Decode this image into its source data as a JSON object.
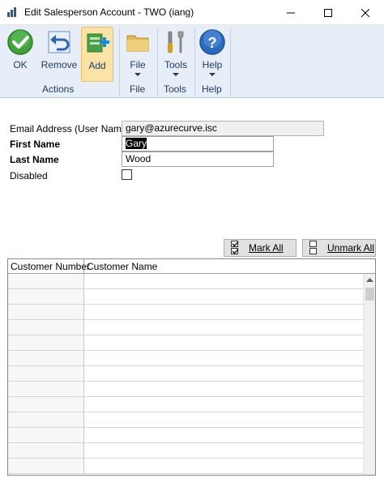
{
  "window": {
    "title": "Edit Salesperson Account  -  TWO (iang)"
  },
  "ribbon": {
    "buttons": [
      {
        "label": "OK",
        "icon": "ok-checkmark-icon"
      },
      {
        "label": "Remove",
        "icon": "undo-arrow-icon"
      },
      {
        "label": "Add",
        "icon": "add-record-icon"
      },
      {
        "label": "File",
        "icon": "folder-icon"
      },
      {
        "label": "Tools",
        "icon": "tools-icon"
      },
      {
        "label": "Help",
        "icon": "help-icon"
      }
    ],
    "groups": {
      "actions": "Actions",
      "file": "File",
      "tools": "Tools",
      "help": "Help"
    }
  },
  "form": {
    "email_label": "Email Address (User Name)",
    "email_value": "gary@azurecurve.isc",
    "first_name_label": "First Name",
    "first_name_value": "Gary",
    "last_name_label": "Last Name",
    "last_name_value": "Wood",
    "disabled_label": "Disabled",
    "disabled_checked": false
  },
  "marks": {
    "mark_all": "Mark All",
    "unmark_all": "Unmark All"
  },
  "grid": {
    "columns": [
      "Customer Number",
      "Customer Name"
    ],
    "rows": [
      [
        "",
        ""
      ],
      [
        "",
        ""
      ],
      [
        "",
        ""
      ],
      [
        "",
        ""
      ],
      [
        "",
        ""
      ],
      [
        "",
        ""
      ],
      [
        "",
        ""
      ],
      [
        "",
        ""
      ],
      [
        "",
        ""
      ],
      [
        "",
        ""
      ],
      [
        "",
        ""
      ],
      [
        "",
        ""
      ],
      [
        "",
        ""
      ]
    ]
  },
  "colors": {
    "ribbon_bg": "#e7eef7",
    "ribbon_text": "#1e3a5f",
    "add_highlight": "#fbe3a6",
    "ok_green": "#3fa33a",
    "help_blue": "#2c6cc0"
  }
}
